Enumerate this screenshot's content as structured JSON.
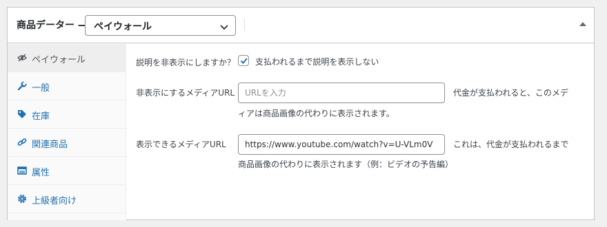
{
  "header": {
    "title": "商品データー —",
    "product_type": "ペイウォール",
    "toggle_icon": "triangle-up-icon"
  },
  "tabs": [
    {
      "label": "ペイウォール",
      "icon": "eye-slash-icon",
      "active": true
    },
    {
      "label": "一般",
      "icon": "wrench-icon",
      "active": false
    },
    {
      "label": "在庫",
      "icon": "tag-icon",
      "active": false
    },
    {
      "label": "関連商品",
      "icon": "link-icon",
      "active": false
    },
    {
      "label": "属性",
      "icon": "list-table-icon",
      "active": false
    },
    {
      "label": "上級者向け",
      "icon": "gear-icon",
      "active": false
    }
  ],
  "fields": {
    "hide_description": {
      "label": "説明を非表示にしますか？",
      "checked": true,
      "text": "支払われるまで説明を表示しない"
    },
    "hidden_media_url": {
      "label": "非表示にするメディアURL",
      "value": "",
      "placeholder": "URLを入力",
      "desc_line1": "代金が支払われると、このメデ",
      "desc_line2": "ィアは商品画像の代わりに表示されます。"
    },
    "visible_media_url": {
      "label": "表示できるメディアURL",
      "value": "https://www.youtube.com/watch?v=U-VLm0V",
      "desc_line1": "これは、代金が支払われるまで",
      "desc_line2": "商品画像の代わりに表示されます（例：ビデオの予告編）"
    }
  },
  "colors": {
    "link": "#2271b1",
    "border": "#c3c4c7",
    "background": "#f0f0f1"
  }
}
